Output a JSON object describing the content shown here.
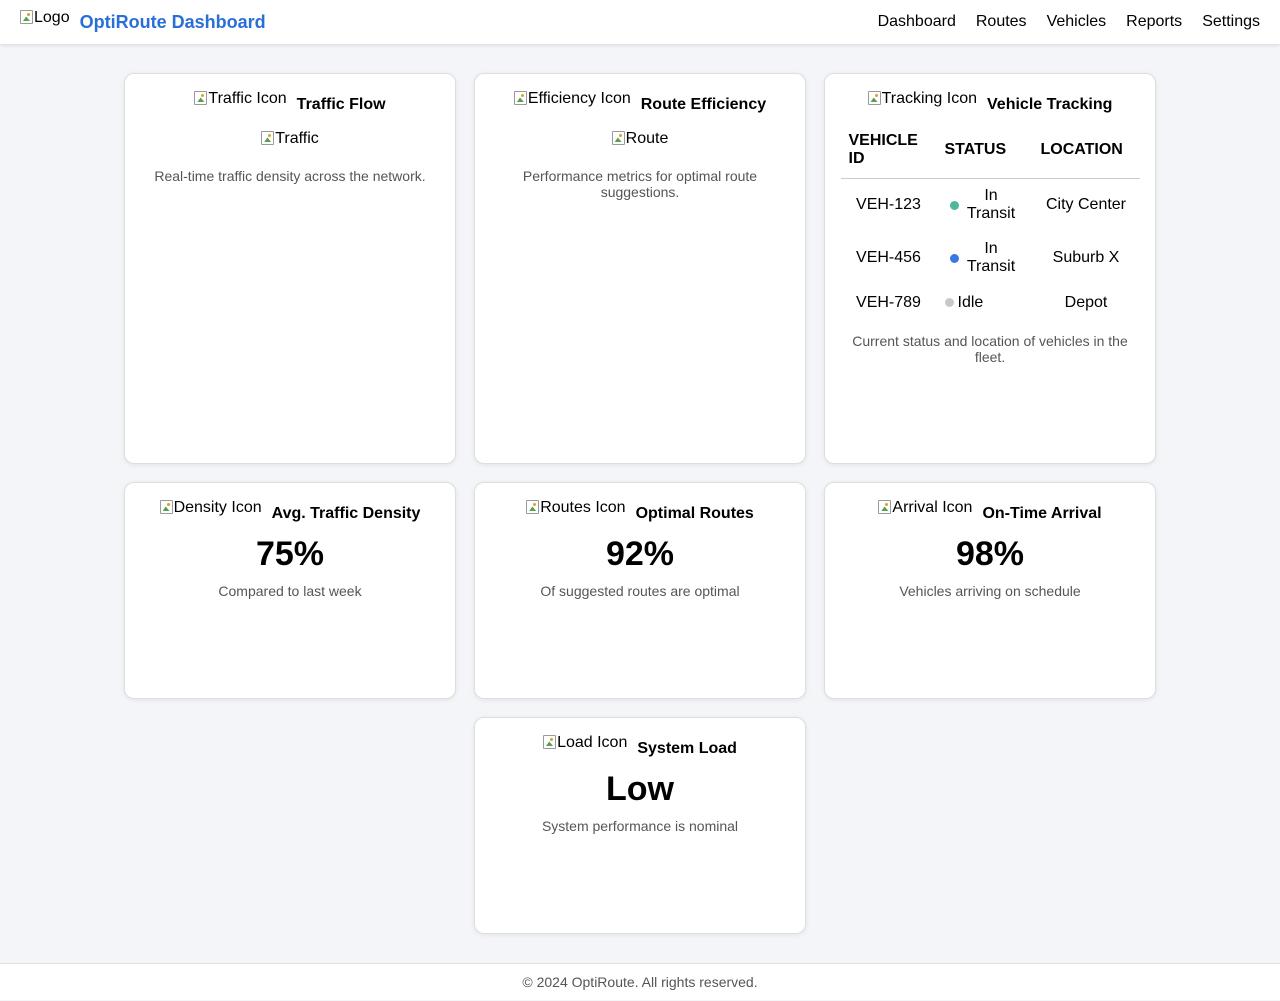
{
  "header": {
    "logo_alt": "Logo",
    "title": "OptiRoute Dashboard",
    "nav": [
      "Dashboard",
      "Routes",
      "Vehicles",
      "Reports",
      "Settings"
    ]
  },
  "cards": {
    "traffic_flow": {
      "icon_alt": "Traffic Icon",
      "title": "Traffic Flow",
      "image_alt": "Traffic",
      "description": "Real-time traffic density across the network."
    },
    "route_efficiency": {
      "icon_alt": "Efficiency Icon",
      "title": "Route Efficiency",
      "image_alt": "Route",
      "description": "Performance metrics for optimal route suggestions."
    },
    "vehicle_tracking": {
      "icon_alt": "Tracking Icon",
      "title": "Vehicle Tracking",
      "columns": [
        "VEHICLE ID",
        "STATUS",
        "LOCATION"
      ],
      "rows": [
        {
          "id": "VEH-123",
          "status": "In Transit",
          "status_color": "#4db89a",
          "location": "City Center"
        },
        {
          "id": "VEH-456",
          "status": "In Transit",
          "status_color": "#3a76e8",
          "location": "Suburb X"
        },
        {
          "id": "VEH-789",
          "status": "Idle",
          "status_color": "#c8c8c8",
          "location": "Depot"
        }
      ],
      "description": "Current status and location of vehicles in the fleet."
    },
    "avg_density": {
      "icon_alt": "Density Icon",
      "title": "Avg. Traffic Density",
      "value": "75%",
      "description": "Compared to last week"
    },
    "optimal_routes": {
      "icon_alt": "Routes Icon",
      "title": "Optimal Routes",
      "value": "92%",
      "description": "Of suggested routes are optimal"
    },
    "on_time": {
      "icon_alt": "Arrival Icon",
      "title": "On-Time Arrival",
      "value": "98%",
      "description": "Vehicles arriving on schedule"
    },
    "system_load": {
      "icon_alt": "Load Icon",
      "title": "System Load",
      "value": "Low",
      "description": "System performance is nominal"
    }
  },
  "footer": {
    "text": "© 2024 OptiRoute. All rights reserved."
  },
  "colors": {
    "brand": "#2a6fd6",
    "background": "#f4f5f8"
  }
}
